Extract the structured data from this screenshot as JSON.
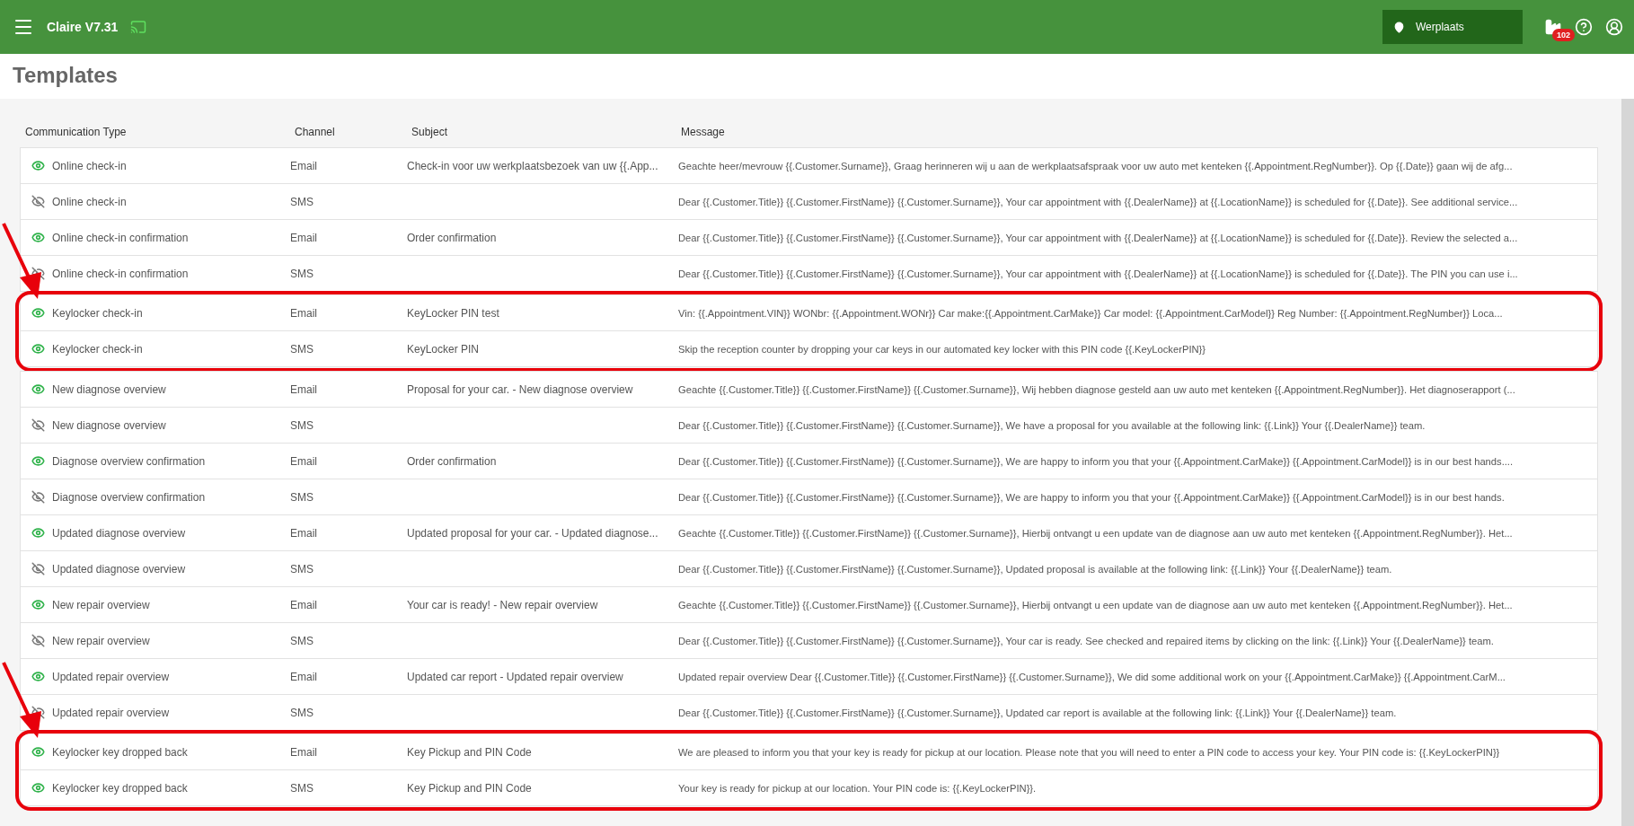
{
  "app_bar": {
    "title": "Claire V7.31",
    "location": "Werplaats",
    "notification_count": "102"
  },
  "page_title": "Templates",
  "table": {
    "columns": [
      "Communication Type",
      "Channel",
      "Subject",
      "Message"
    ],
    "groups": [
      {
        "highlighted": false,
        "rows": [
          {
            "visible": true,
            "type": "Online check-in",
            "channel": "Email",
            "subject": "Check-in voor uw werkplaatsbezoek van uw {{.App...",
            "message": "Geachte heer/mevrouw {{.Customer.Surname}}, Graag herinneren wij u aan de werkplaatsafspraak voor uw auto met kenteken {{.Appointment.RegNumber}}. Op {{.Date}} gaan wij de afg..."
          },
          {
            "visible": false,
            "type": "Online check-in",
            "channel": "SMS",
            "subject": "",
            "message": "Dear {{.Customer.Title}} {{.Customer.FirstName}} {{.Customer.Surname}}, Your car appointment with {{.DealerName}} at {{.LocationName}} is scheduled for {{.Date}}. See additional service..."
          },
          {
            "visible": true,
            "type": "Online check-in confirmation",
            "channel": "Email",
            "subject": "Order confirmation",
            "message": "Dear {{.Customer.Title}} {{.Customer.FirstName}} {{.Customer.Surname}}, Your car appointment with {{.DealerName}} at {{.LocationName}} is scheduled for {{.Date}}. Review the selected a..."
          },
          {
            "visible": false,
            "type": "Online check-in confirmation",
            "channel": "SMS",
            "subject": "",
            "message": "Dear {{.Customer.Title}} {{.Customer.FirstName}} {{.Customer.Surname}}, Your car appointment with {{.DealerName}} at {{.LocationName}} is scheduled for {{.Date}}. The PIN you can use i..."
          }
        ]
      },
      {
        "highlighted": true,
        "rows": [
          {
            "visible": true,
            "type": "Keylocker check-in",
            "channel": "Email",
            "subject": "KeyLocker PIN test",
            "message": "Vin: {{.Appointment.VIN}} WONbr: {{.Appointment.WONr}} Car make:{{.Appointment.CarMake}} Car model: {{.Appointment.CarModel}} Reg Number: {{.Appointment.RegNumber}} Loca..."
          },
          {
            "visible": true,
            "type": "Keylocker check-in",
            "channel": "SMS",
            "subject": "KeyLocker PIN",
            "message": "Skip the reception counter by dropping your car keys in our automated key locker with this PIN code {{.KeyLockerPIN}}"
          }
        ]
      },
      {
        "highlighted": false,
        "rows": [
          {
            "visible": true,
            "type": "New diagnose overview",
            "channel": "Email",
            "subject": "Proposal for your car. - New diagnose overview",
            "message": "Geachte {{.Customer.Title}} {{.Customer.FirstName}} {{.Customer.Surname}}, Wij hebben diagnose gesteld aan uw auto met kenteken {{.Appointment.RegNumber}}. Het diagnoserapport (..."
          },
          {
            "visible": false,
            "type": "New diagnose overview",
            "channel": "SMS",
            "subject": "",
            "message": "Dear {{.Customer.Title}} {{.Customer.FirstName}} {{.Customer.Surname}}, We have a proposal for you available at the following link: {{.Link}} Your {{.DealerName}} team."
          },
          {
            "visible": true,
            "type": "Diagnose overview confirmation",
            "channel": "Email",
            "subject": "Order confirmation",
            "message": "Dear {{.Customer.Title}} {{.Customer.FirstName}} {{.Customer.Surname}}, We are happy to inform you that your {{.Appointment.CarMake}} {{.Appointment.CarModel}} is in our best hands...."
          },
          {
            "visible": false,
            "type": "Diagnose overview confirmation",
            "channel": "SMS",
            "subject": "",
            "message": "Dear {{.Customer.Title}} {{.Customer.FirstName}} {{.Customer.Surname}}, We are happy to inform you that your {{.Appointment.CarMake}} {{.Appointment.CarModel}} is in our best hands."
          },
          {
            "visible": true,
            "type": "Updated diagnose overview",
            "channel": "Email",
            "subject": "Updated proposal for your car. - Updated diagnose...",
            "message": "Geachte {{.Customer.Title}} {{.Customer.FirstName}} {{.Customer.Surname}}, Hierbij ontvangt u een update van de diagnose aan uw auto met kenteken {{.Appointment.RegNumber}}. Het..."
          },
          {
            "visible": false,
            "type": "Updated diagnose overview",
            "channel": "SMS",
            "subject": "",
            "message": "Dear {{.Customer.Title}} {{.Customer.FirstName}} {{.Customer.Surname}}, Updated proposal is available at the following link: {{.Link}} Your {{.DealerName}} team."
          },
          {
            "visible": true,
            "type": "New repair overview",
            "channel": "Email",
            "subject": "Your car is ready! - New repair overview",
            "message": "Geachte {{.Customer.Title}} {{.Customer.FirstName}} {{.Customer.Surname}}, Hierbij ontvangt u een update van de diagnose aan uw auto met kenteken {{.Appointment.RegNumber}}. Het..."
          },
          {
            "visible": false,
            "type": "New repair overview",
            "channel": "SMS",
            "subject": "",
            "message": "Dear {{.Customer.Title}} {{.Customer.FirstName}} {{.Customer.Surname}}, Your car is ready. See checked and repaired items by clicking on the link: {{.Link}} Your {{.DealerName}} team."
          },
          {
            "visible": true,
            "type": "Updated repair overview",
            "channel": "Email",
            "subject": "Updated car report - Updated repair overview",
            "message": "Updated repair overview Dear {{.Customer.Title}} {{.Customer.FirstName}} {{.Customer.Surname}}, We did some additional work on your {{.Appointment.CarMake}} {{.Appointment.CarM..."
          },
          {
            "visible": false,
            "type": "Updated repair overview",
            "channel": "SMS",
            "subject": "",
            "message": "Dear {{.Customer.Title}} {{.Customer.FirstName}} {{.Customer.Surname}}, Updated car report is available at the following link: {{.Link}} Your {{.DealerName}} team."
          }
        ]
      },
      {
        "highlighted": true,
        "rows": [
          {
            "visible": true,
            "type": "Keylocker key dropped back",
            "channel": "Email",
            "subject": "Key Pickup and PIN Code",
            "message": "We are pleased to inform you that your key is ready for pickup at our location. Please note that you will need to enter a PIN code to access your key. Your PIN code is: {{.KeyLockerPIN}}"
          },
          {
            "visible": true,
            "type": "Keylocker key dropped back",
            "channel": "SMS",
            "subject": "Key Pickup and PIN Code",
            "message": "Your key is ready for pickup at our location. Your PIN code is: {{.KeyLockerPIN}}."
          }
        ]
      }
    ]
  }
}
